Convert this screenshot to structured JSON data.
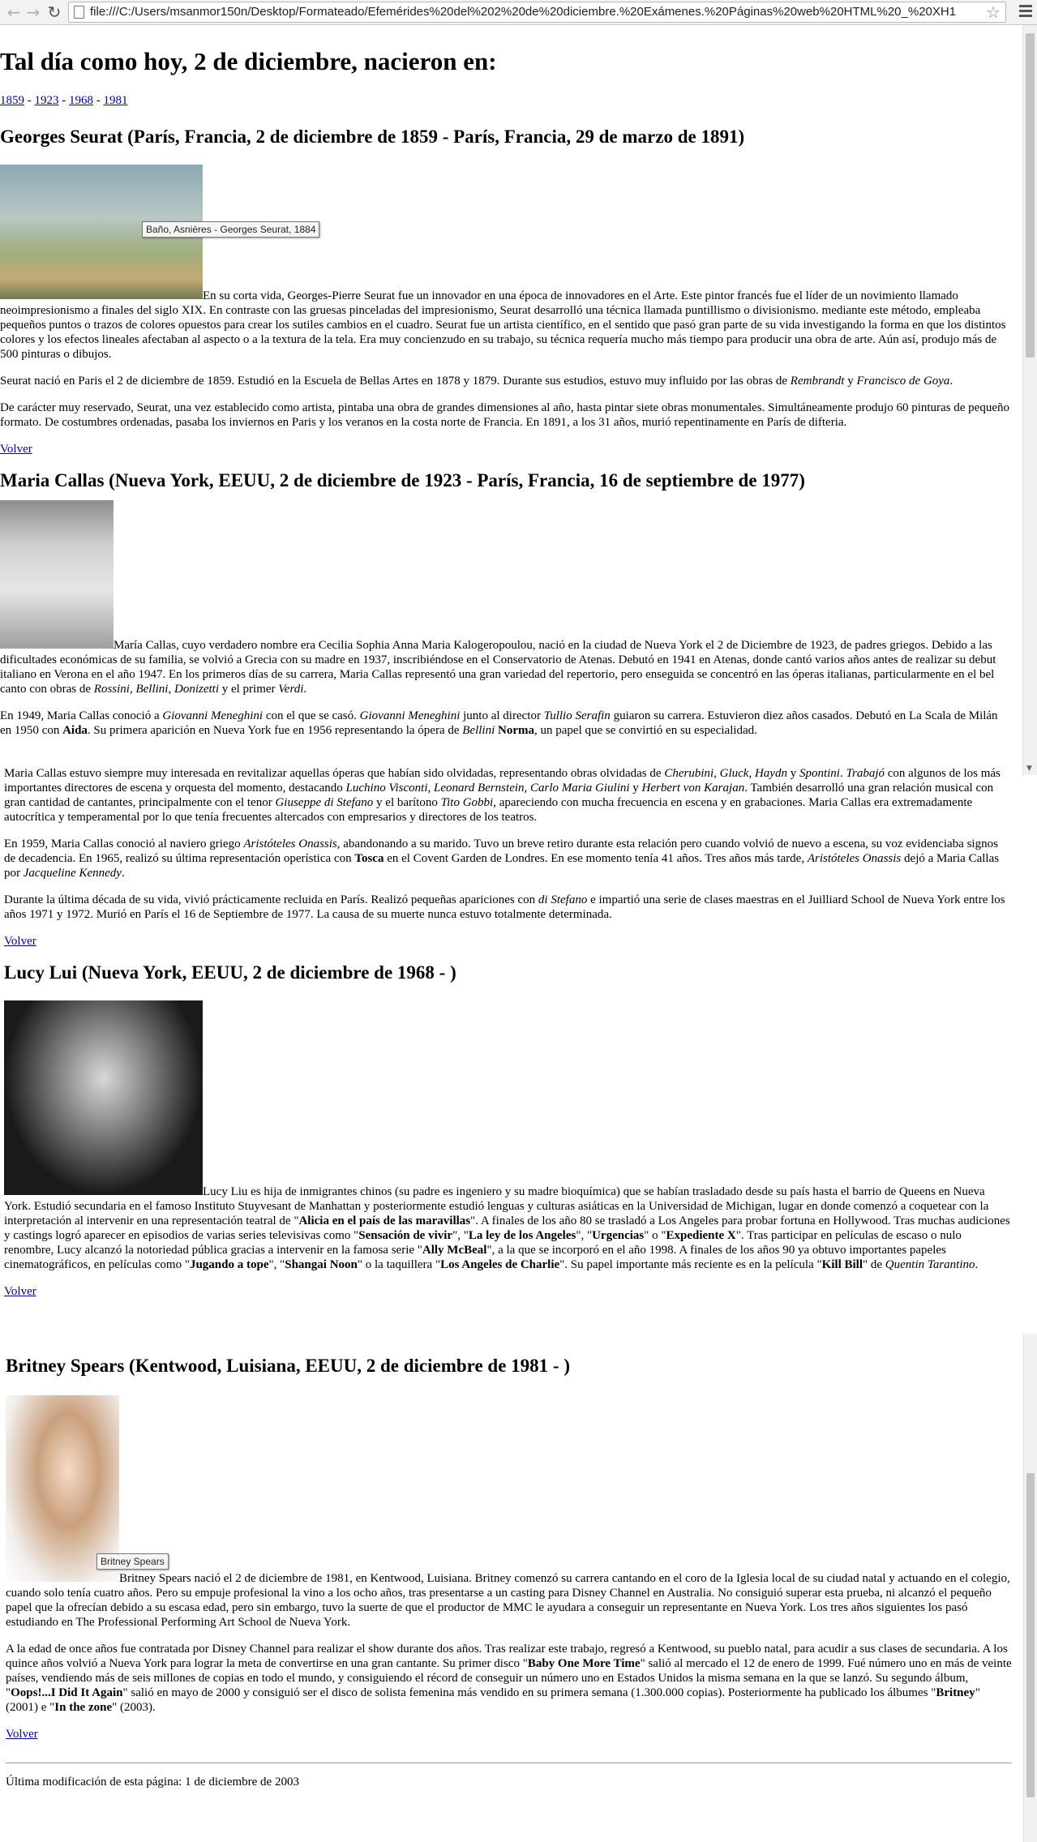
{
  "browser": {
    "url": "file:///C:/Users/msanmor150n/Desktop/Formateado/Efemérides%20del%202%20de%20diciembre.%20Exámenes.%20Páginas%20web%20HTML%20_%20XH1"
  },
  "page": {
    "title": "Tal día como hoy, 2 de diciembre, nacieron en:",
    "years": [
      "1859",
      "1923",
      "1968",
      "1981"
    ],
    "sep": " - ",
    "back": "Volver",
    "footer": "Última modificación de esta página: 1 de diciembre de 2003"
  },
  "seurat": {
    "heading": "Georges Seurat (París, Francia, 2 de diciembre de 1859 - París, Francia, 29 de marzo de 1891)",
    "tooltip": "Baño, Asnières - Georges Seurat, 1884",
    "p1": "En su corta vida, Georges-Pierre Seurat fue un innovador en una época de innovadores en el Arte. Este pintor francés fue el líder de un novimiento llamado neoimpresionismo a finales del siglo XIX. En contraste con las gruesas pinceladas del impresionismo, Seurat desarrolló una técnica llamada puntillismo o divisionismo. mediante este método, empleaba pequeños puntos o trazos de colores opuestos para crear los sutiles cambios en el cuadro. Seurat fue un artista científico, en el sentido que pasó gran parte de su vida investigando la forma en que los distintos colores y los efectos lineales afectaban al aspecto o a la textura de la tela. Era muy concienzudo en su trabajo, su técnica requería mucho más tiempo para producir una obra de arte. Aún así, produjo más de 500 pinturas o dibujos.",
    "p2a": "Seurat nació en Paris el 2 de diciembre de 1859. Estudió en la Escuela de Bellas Artes en 1878 y 1879. Durante sus estudios, estuvo muy influido por las obras de ",
    "p2b": "Rembrandt",
    "p2c": " y ",
    "p2d": "Francisco de Goya",
    "p2e": ".",
    "p3": "De carácter muy reservado, Seurat, una vez establecido como artista, pintaba una obra de grandes dimensiones al año, hasta pintar siete obras monumentales. Simultáneamente produjo 60 pinturas de pequeño formato. De costumbres ordenadas, pasaba los inviernos en Paris y los veranos en la costa norte de Francia. En 1891, a los 31 años, murió repentinamente en París de difteria."
  },
  "callas": {
    "heading": "Maria Callas (Nueva York, EEUU, 2 de diciembre de 1923 - París, Francia, 16 de septiembre de 1977)",
    "p1a": "María Callas, cuyo verdadero nombre era Cecilia Sophia Anna Maria Kalogeropoulou, nació en la ciudad de Nueva York el 2 de Diciembre de 1923, de padres griegos. Debido a las dificultades económicas de su familia, se volvió a Grecia con su madre en 1937, inscribiéndose en el Conservatorio de Atenas. Debutó en 1941 en Atenas, donde cantó varios años antes de realizar su debut italiano en Verona en el año 1947. En los primeros días de su carrera, Maria Callas representó una gran variedad del repertorio, pero enseguida se concentró en las óperas italianas, particularmente en el bel canto con obras de ",
    "p1b": "Rossini",
    "p1c": "Bellini",
    "p1d": "Donizetti",
    "p1e": " y el primer ",
    "p1f": "Verdi",
    "p2a": "En 1949, Maria Callas conoció a ",
    "p2b": "Giovanni Meneghini",
    "p2c": " con el que se casó. ",
    "p2d": "Giovanni Meneghini",
    "p2e": " junto al director ",
    "p2f": "Tullio Serafin",
    "p2g": " guiaron su carrera. Estuvieron diez años casados. Debutó en La Scala de Milán en 1950 con ",
    "p2h": "Aida",
    "p2i": ". Su primera aparición en Nueva York fue en 1956 representando la ópera de ",
    "p2j": "Bellini",
    "p2k": "Norma",
    "p2l": ", un papel que se convirtió en su especialidad.",
    "p3a": "Maria Callas estuvo siempre muy interesada en revitalizar aquellas óperas que habían sido olvidadas, representando obras olvidadas de ",
    "p3b": "Cherubini, Gluck, Haydn",
    "p3c": " y ",
    "p3d": "Spontini",
    "p3e": ". ",
    "p3f": "Trabajó",
    "p3g": " con algunos de los más importantes directores de escena y orquesta del momento, destacando ",
    "p3h": "Luchino Visconti, Leonard Bernstein, Carlo Maria Giulini",
    "p3i": " y ",
    "p3j": "Herbert von Karajan",
    "p3k": ". También desarrolló una gran relación musical con gran cantidad de cantantes, principalmente con el tenor ",
    "p3l": "Giuseppe di Stefano",
    "p3m": " y el barítono ",
    "p3n": "Tito Gobbi",
    "p3o": ", apareciendo con mucha frecuencia en escena y en grabaciones. Maria Callas era extremadamente autocrítica y temperamental por lo que tenía frecuentes altercados con empresarios y directores de los teatros.",
    "p4a": "En 1959, Maria Callas conoció al naviero griego ",
    "p4b": "Aristóteles Onassis",
    "p4c": ", abandonando a su marido. Tuvo un breve retiro durante esta relación pero cuando volvió de nuevo a escena, su voz evidenciaba signos de decadencia. En 1965, realizó su última representación operística con ",
    "p4d": "Tosca",
    "p4e": " en el Covent Garden de Londres. En ese momento tenía 41 años. Tres años más tarde, ",
    "p4f": "Aristóteles Onassis",
    "p4g": " dejó a Maria Callas por ",
    "p4h": "Jacqueline Kennedy",
    "p5a": "Durante la última década de su vida, vivió prácticamente recluida en París. Realizó pequeñas apariciones con ",
    "p5b": "di Stefano",
    "p5c": " e impartió una serie de clases maestras en el Juilliard School de Nueva York entre los años 1971 y 1972. Murió en París el 16 de Septiembre de 1977. La causa de su muerte nunca estuvo totalmente determinada."
  },
  "lucy": {
    "heading": "Lucy Lui (Nueva York, EEUU, 2 de diciembre de 1968 - )",
    "t1": "Lucy Liu es hija de inmigrantes chinos (su padre es ingeniero y su madre bioquímica) que se habían trasladado desde su país hasta el barrio de Queens en Nueva York. Estudió secundaria en el famoso Instituto Stuyvesant de Manhattan y posteriormente estudió lenguas y culturas asiáticas en la Universidad de Michigan, lugar en donde comenzó a coquetear con la interpretación al intervenir en una representación teatral de \"",
    "b1": "Alicia en el país de las maravillas",
    "t2": "\". A finales de los año 80 se trasladó a Los Angeles para probar fortuna en Hollywood. Tras muchas audiciones y castings logró aparecer en episodios de varias series televisivas como \"",
    "b2": "Sensación de vivir",
    "t3": "\", \"",
    "b3": "La ley de los Angeles",
    "t4": "\", \"",
    "b4": "Urgencias",
    "t5": "\" o \"",
    "b5": "Expediente X",
    "t6": "\". Tras participar en películas de escaso o nulo renombre, Lucy alcanzó la notoriedad pública gracias a intervenir en la famosa serie \"",
    "b6": "Ally McBeal",
    "t7": "\", a la que se incorporó en el año 1998. A finales de los años 90 ya obtuvo importantes papeles cinematográficos, en películas como \"",
    "b7": "Jugando a tope",
    "t8": "\", \"",
    "b8": "Shangai Noon",
    "t9": "\" o la taquillera \"",
    "b9": "Los Angeles de Charlie",
    "t10": "\". Su papel importante más reciente es en la película \"",
    "b10": "Kill Bill",
    "t11": "\" de ",
    "i11": "Quentin Tarantino",
    "t12": "."
  },
  "britney": {
    "heading": "Britney Spears (Kentwood, Luisiana, EEUU, 2 de diciembre de 1981 - )",
    "tooltip": "Britney Spears",
    "p1": "Britney Spears nació el 2 de diciembre de 1981, en Kentwood, Luisiana. Britney comenzó su carrera cantando en el coro de la Iglesia local de su ciudad natal y actuando en el colegio, cuando solo tenía cuatro años. Pero su empuje profesional la vino a los ocho años, tras presentarse a un casting para Disney Channel en Australia. No consiguió superar esta prueba, ni alcanzó el pequeño papel que la ofrecían debido a su escasa edad, pero sin embargo, tuvo la suerte de que el productor de MMC le ayudara a conseguir un representante en Nueva York. Los tres años siguientes los pasó estudiando en The Professional Performing Art School de Nueva York.",
    "p2a": "A la edad de once años fue contratada por Disney Channel para realizar el show durante dos años. Tras realizar este trabajo, regresó a Kentwood, su pueblo natal, para acudir a sus clases de secundaria. A los quince años volvió a Nueva York para lograr la meta de convertirse en una gran cantante. Su primer disco \"",
    "p2b": "Baby One More Time",
    "p2c": "\" salió al mercado el 12 de enero de 1999. Fué número uno en más de veinte países, vendiendo más de seis millones de copias en todo el mundo, y consiguiendo el récord de conseguir un número uno en Estados Unidos la misma semana en la que se lanzó. Su segundo álbum, \"",
    "p2d": "Oops!...I Did It Again",
    "p2e": "\" salió en mayo de 2000 y consiguió ser el disco de solista femenina más vendido en su primera semana (1.300.000 copias). Posteriormente ha publicado los álbumes \"",
    "p2f": "Britney",
    "p2g": "\" (2001) e \"",
    "p2h": "In the zone",
    "p2i": "\" (2003)."
  }
}
